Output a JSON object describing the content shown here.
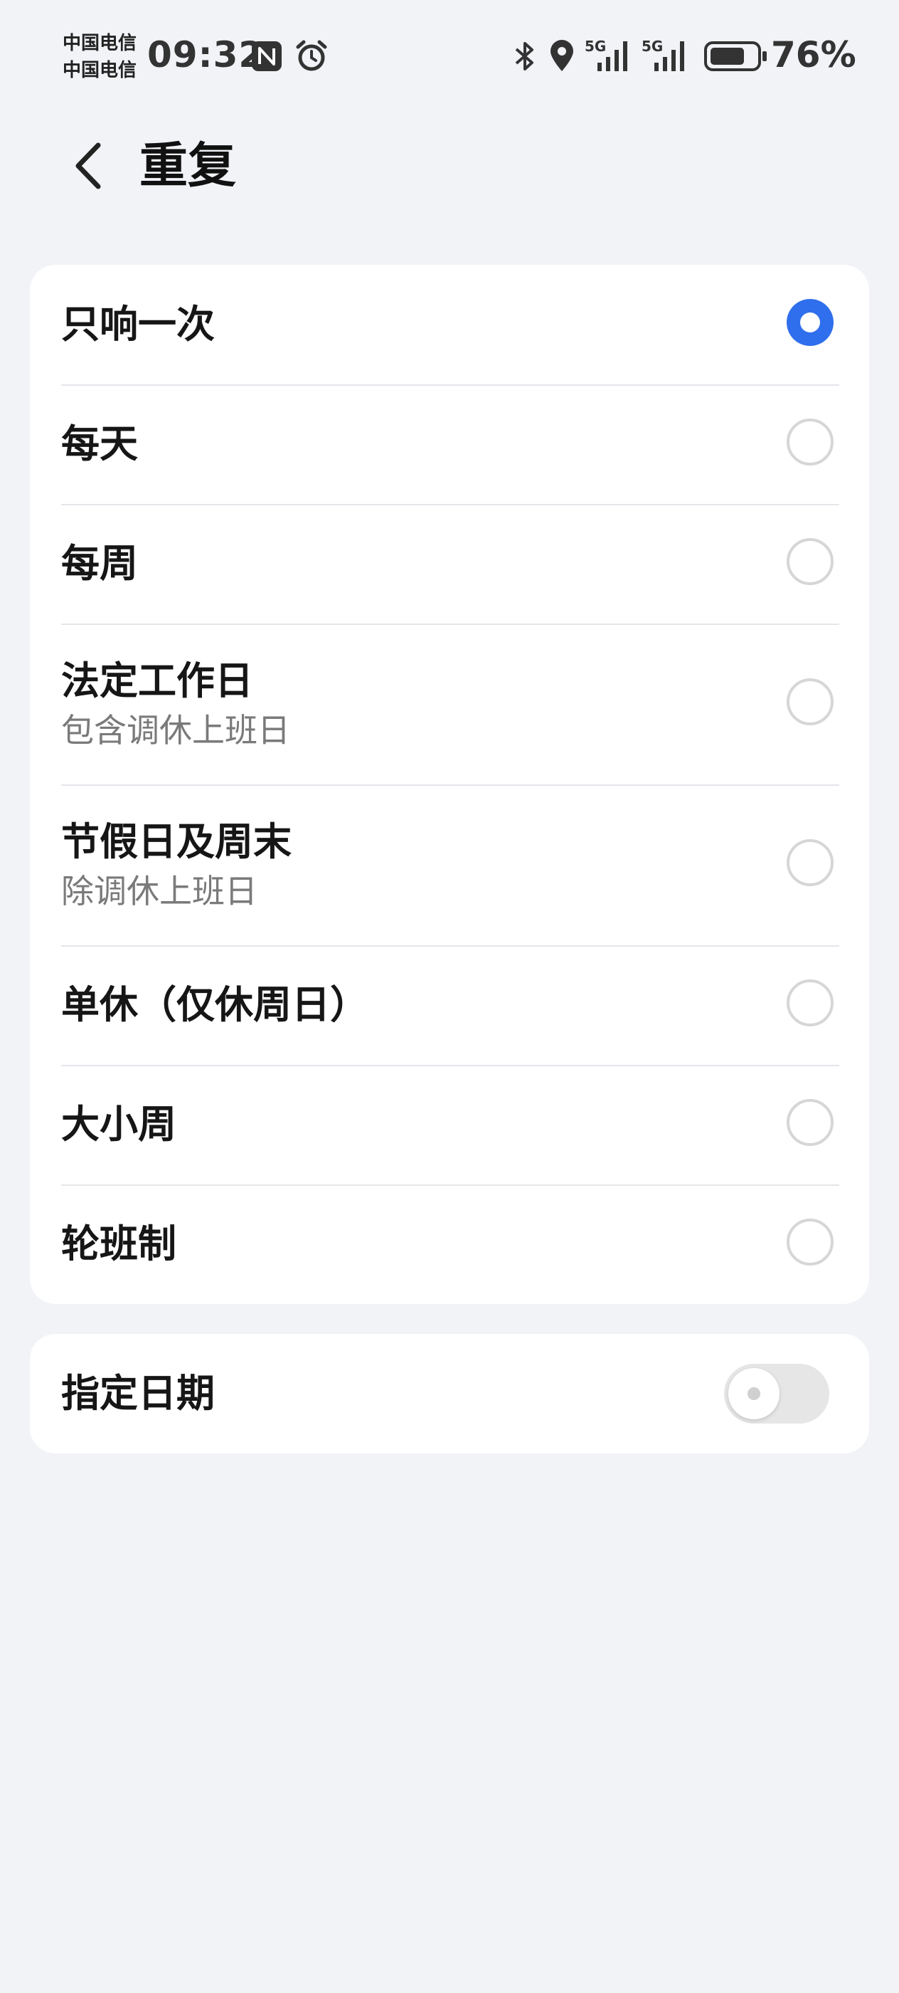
{
  "status_bar": {
    "carrier_1": "中国电信",
    "carrier_2": "中国电信",
    "time": "09:32",
    "signal_1_label": "5G",
    "signal_2_label": "5G",
    "battery_percent": "76%",
    "battery_level": 0.76,
    "icons": [
      "nfc-icon",
      "alarm-icon",
      "bluetooth-icon",
      "location-icon",
      "signal-icon",
      "battery-icon"
    ]
  },
  "header": {
    "back_icon": "chevron-left-icon",
    "title": "重复"
  },
  "options": [
    {
      "label": "只响一次",
      "sub": "",
      "selected": true
    },
    {
      "label": "每天",
      "sub": "",
      "selected": false
    },
    {
      "label": "每周",
      "sub": "",
      "selected": false
    },
    {
      "label": "法定工作日",
      "sub": "包含调休上班日",
      "selected": false
    },
    {
      "label": "节假日及周末",
      "sub": "除调休上班日",
      "selected": false
    },
    {
      "label": "单休（仅休周日）",
      "sub": "",
      "selected": false
    },
    {
      "label": "大小周",
      "sub": "",
      "selected": false
    },
    {
      "label": "轮班制",
      "sub": "",
      "selected": false
    }
  ],
  "specified_date": {
    "label": "指定日期",
    "enabled": false
  },
  "colors": {
    "accent": "#2f6fed",
    "background": "#f1f3f7",
    "card": "#ffffff",
    "subtext": "#7a7a7a"
  }
}
